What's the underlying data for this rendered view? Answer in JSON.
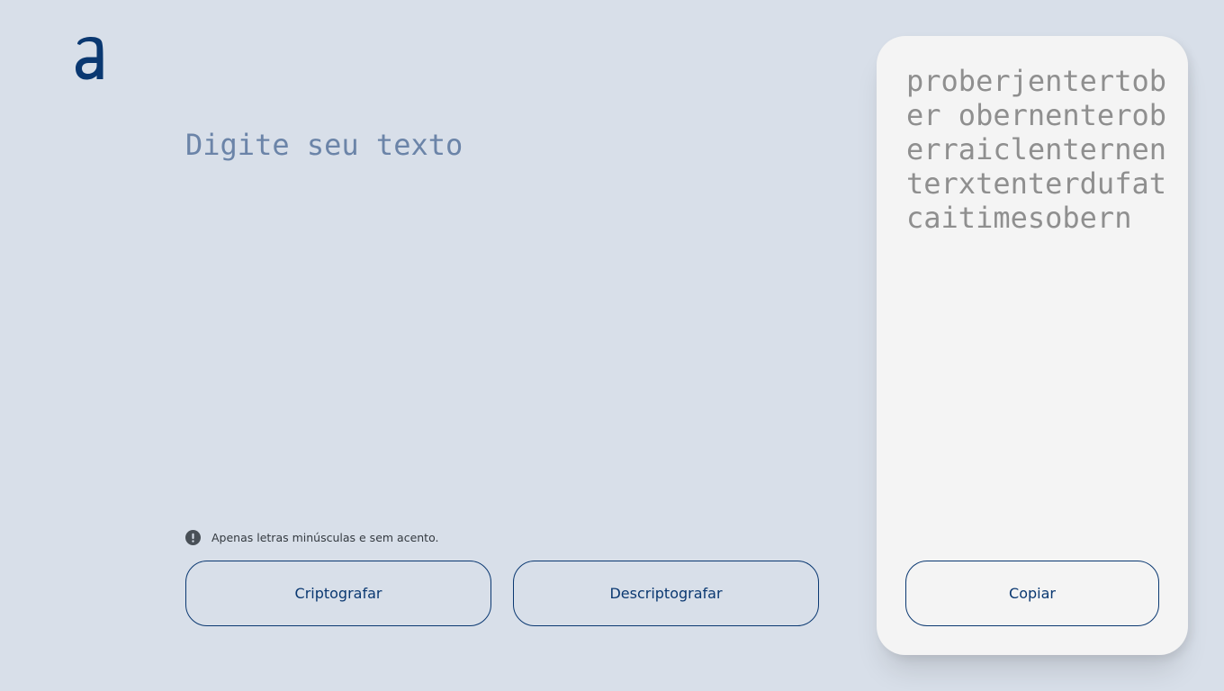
{
  "logo": {
    "alt": "Alura logo"
  },
  "input": {
    "placeholder": "Digite seu texto",
    "value": ""
  },
  "hint": {
    "icon": "exclamation-circle-icon",
    "text": "Apenas letras minúsculas e sem acento."
  },
  "buttons": {
    "encrypt_label": "Criptografar",
    "decrypt_label": "Descriptografar"
  },
  "output": {
    "text": "proberjentertober obernenteroberraiclenternenterxtenterdufatcaitimesobern",
    "copy_label": "Copiar"
  },
  "colors": {
    "background": "#d8dfe9",
    "accent": "#0a3871",
    "panel": "#f4f4f4",
    "placeholder": "#6b84a8",
    "output_text": "#8f8f8f"
  }
}
